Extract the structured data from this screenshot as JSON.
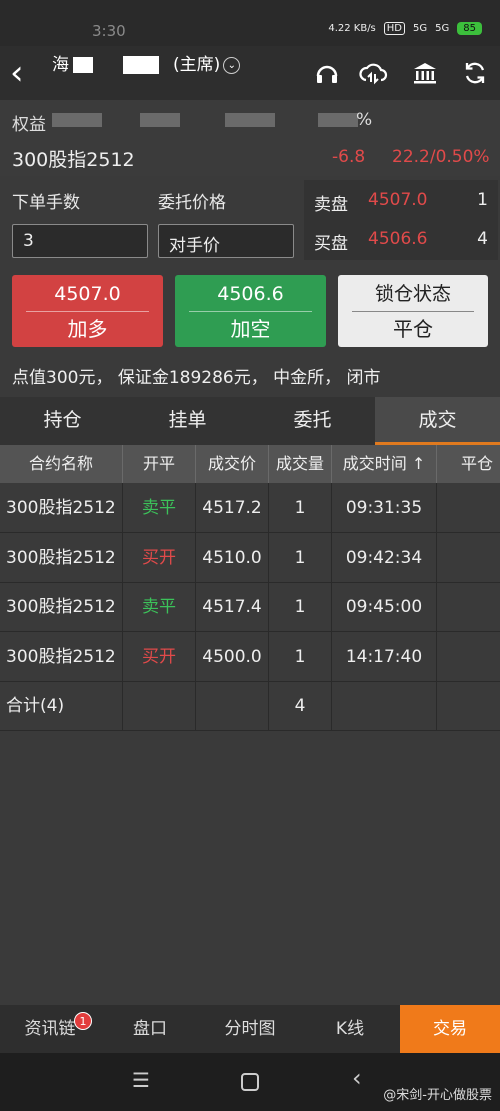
{
  "status_bar": {
    "time": "3:30",
    "net_speed": "4.22 KB/s",
    "hd": "HD",
    "signal1": "5G",
    "signal2": "5G",
    "battery": "85"
  },
  "header": {
    "title_prefix": "海",
    "title_suffix": "(主席)"
  },
  "info": {
    "equity_label": "权益",
    "contract_name": "300股指2512",
    "pct_suffix": "%",
    "price_change": "-6.8",
    "change_pct": "22.2/0.50%"
  },
  "order": {
    "qty_label": "下单手数",
    "price_label": "委托价格",
    "qty_value": "3",
    "price_value": "对手价"
  },
  "quote": {
    "sell_label": "卖盘",
    "sell_price": "4507.0",
    "sell_vol": "1",
    "buy_label": "买盘",
    "buy_price": "4506.6",
    "buy_vol": "4"
  },
  "buttons": {
    "buy_price": "4507.0",
    "buy_label": "加多",
    "sell_price": "4506.6",
    "sell_label": "加空",
    "lock_label": "锁仓状态",
    "close_label": "平仓"
  },
  "description": "点值300元， 保证金189286元， 中金所， 闭市",
  "tabs": [
    "持仓",
    "挂单",
    "委托",
    "成交"
  ],
  "table": {
    "headers": [
      "合约名称",
      "开平",
      "成交价",
      "成交量",
      "成交时间 ↑",
      "平仓"
    ],
    "rows": [
      {
        "name": "300股指2512",
        "side": "卖平",
        "side_color": "#3cc25a",
        "price": "4517.2",
        "qty": "1",
        "time": "09:31:35"
      },
      {
        "name": "300股指2512",
        "side": "买开",
        "side_color": "#e04a4a",
        "price": "4510.0",
        "qty": "1",
        "time": "09:42:34"
      },
      {
        "name": "300股指2512",
        "side": "卖平",
        "side_color": "#3cc25a",
        "price": "4517.4",
        "qty": "1",
        "time": "09:45:00"
      },
      {
        "name": "300股指2512",
        "side": "买开",
        "side_color": "#e04a4a",
        "price": "4500.0",
        "qty": "1",
        "time": "14:17:40"
      }
    ],
    "total_label": "合计(4)",
    "total_qty": "4"
  },
  "bottom_nav": [
    {
      "label": "资讯链",
      "badge": "1"
    },
    {
      "label": "盘口"
    },
    {
      "label": "分时图"
    },
    {
      "label": "K线"
    },
    {
      "label": "交易"
    }
  ],
  "watermark": "@宋剑-开心做股票",
  "colors": {
    "accent": "#f07a1a",
    "up": "#e04a4a",
    "down": "#3cc25a"
  }
}
